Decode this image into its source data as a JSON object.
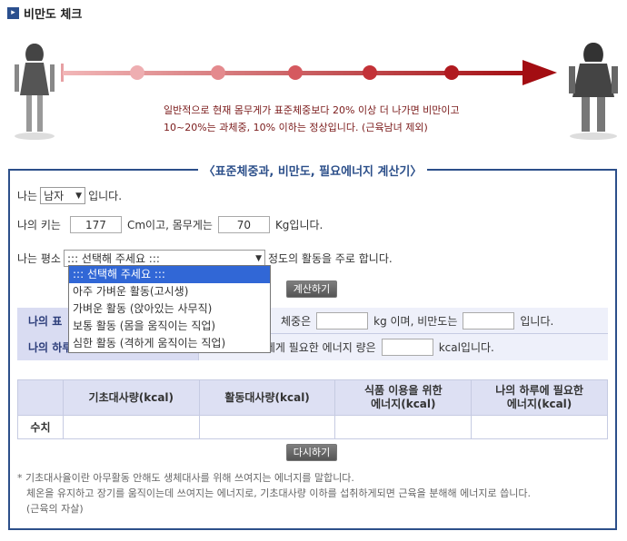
{
  "page": {
    "title": "비만도 체크"
  },
  "banner": {
    "info_line1": "일반적으로 현재 몸무게가 표준체중보다 20% 이상 더 나가면 비만이고",
    "info_line2": "10~20%는 과체중, 10% 이하는 정상입니다. (근육남녀 제외)"
  },
  "calculator": {
    "title": "〈표준체중과, 비만도, 필요에너지 계산기〉",
    "gender_prefix": "나는",
    "gender_value": "남자",
    "gender_suffix": "입니다.",
    "height_prefix": "나의 키는",
    "height_value": "177",
    "height_unit": "Cm이고, 몸무게는",
    "weight_value": "70",
    "weight_suffix": "Kg입니다.",
    "activity_prefix": "나는 평소",
    "activity_selected": "::: 선택해 주세요 :::",
    "activity_suffix": "정도의 활동을 주로 합니다.",
    "activity_options": [
      "::: 선택해 주세요 :::",
      "아주 가벼운 활동(고시생)",
      "가벼운 활동 (앉아있는 사무직)",
      "보통 활동 (몸을 움직이는 직업)",
      "심한 활동 (격하게 움직이는 직업)"
    ],
    "calc_button": "계산하기",
    "result1_label": "나의 표",
    "result1_text_a": "체중은",
    "result1_unit": "kg 이며, 비만도는",
    "result1_suffix": "입니다.",
    "result2_label": "나의 하루 필요 에너지 결과",
    "result2_text_a": "하루 동안 나에게 필요한 에너지 량은",
    "result2_suffix": "kcal입니다.",
    "table_headers": [
      "",
      "기초대사량(kcal)",
      "활동대사량(kcal)",
      "식품 이용을 위한\n에너지(kcal)",
      "나의 하루에 필요한\n에너지(kcal)"
    ],
    "table_row_label": "수치",
    "reset_button": "다시하기",
    "notes": [
      "* 기초대사율이란 아무활동 안해도 생체대사를 위해 쓰여지는 에너지를 말합니다.",
      "체온을 유지하고 장기를 움직이는데 쓰여지는 에너지로, 기초대사량 이하를 섭취하게되면 근육을 분해해 에너지로 씁니다.",
      "(근육의 자살)"
    ]
  },
  "colors": {
    "accent_blue": "#2c4f8a",
    "arrow_red": "#b3161b",
    "highlight_blue": "#3167d6"
  }
}
